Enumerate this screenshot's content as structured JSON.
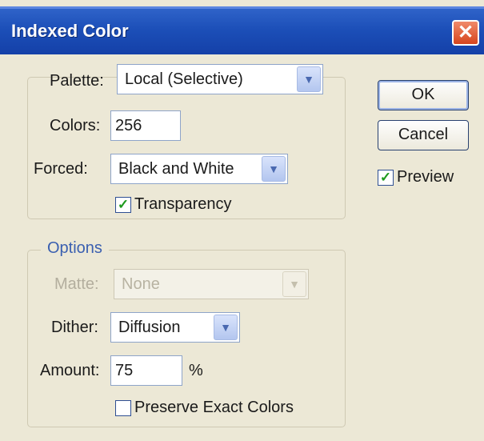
{
  "window": {
    "title": "Indexed Color",
    "close_glyph": "✕"
  },
  "palette_group": {
    "palette_label": "Palette:",
    "palette_value": "Local (Selective)",
    "colors_label": "Colors:",
    "colors_value": "256",
    "forced_label": "Forced:",
    "forced_value": "Black and White",
    "transparency_label": "Transparency",
    "transparency_checked": true
  },
  "options_group": {
    "legend": "Options",
    "matte_label": "Matte:",
    "matte_value": "None",
    "matte_enabled": false,
    "dither_label": "Dither:",
    "dither_value": "Diffusion",
    "amount_label": "Amount:",
    "amount_value": "75",
    "amount_unit": "%",
    "preserve_label": "Preserve Exact Colors",
    "preserve_checked": false
  },
  "buttons": {
    "ok": "OK",
    "cancel": "Cancel"
  },
  "preview": {
    "label": "Preview",
    "checked": true
  },
  "icons": {
    "check": "✓",
    "dropdown_arrow": "▼"
  },
  "colors": {
    "titlebar": "#1c4fb8",
    "close_button": "#d6451e",
    "dialog_bg": "#ece8d6",
    "legend_text": "#3a5fb0",
    "check_mark": "#1e9a1e"
  }
}
